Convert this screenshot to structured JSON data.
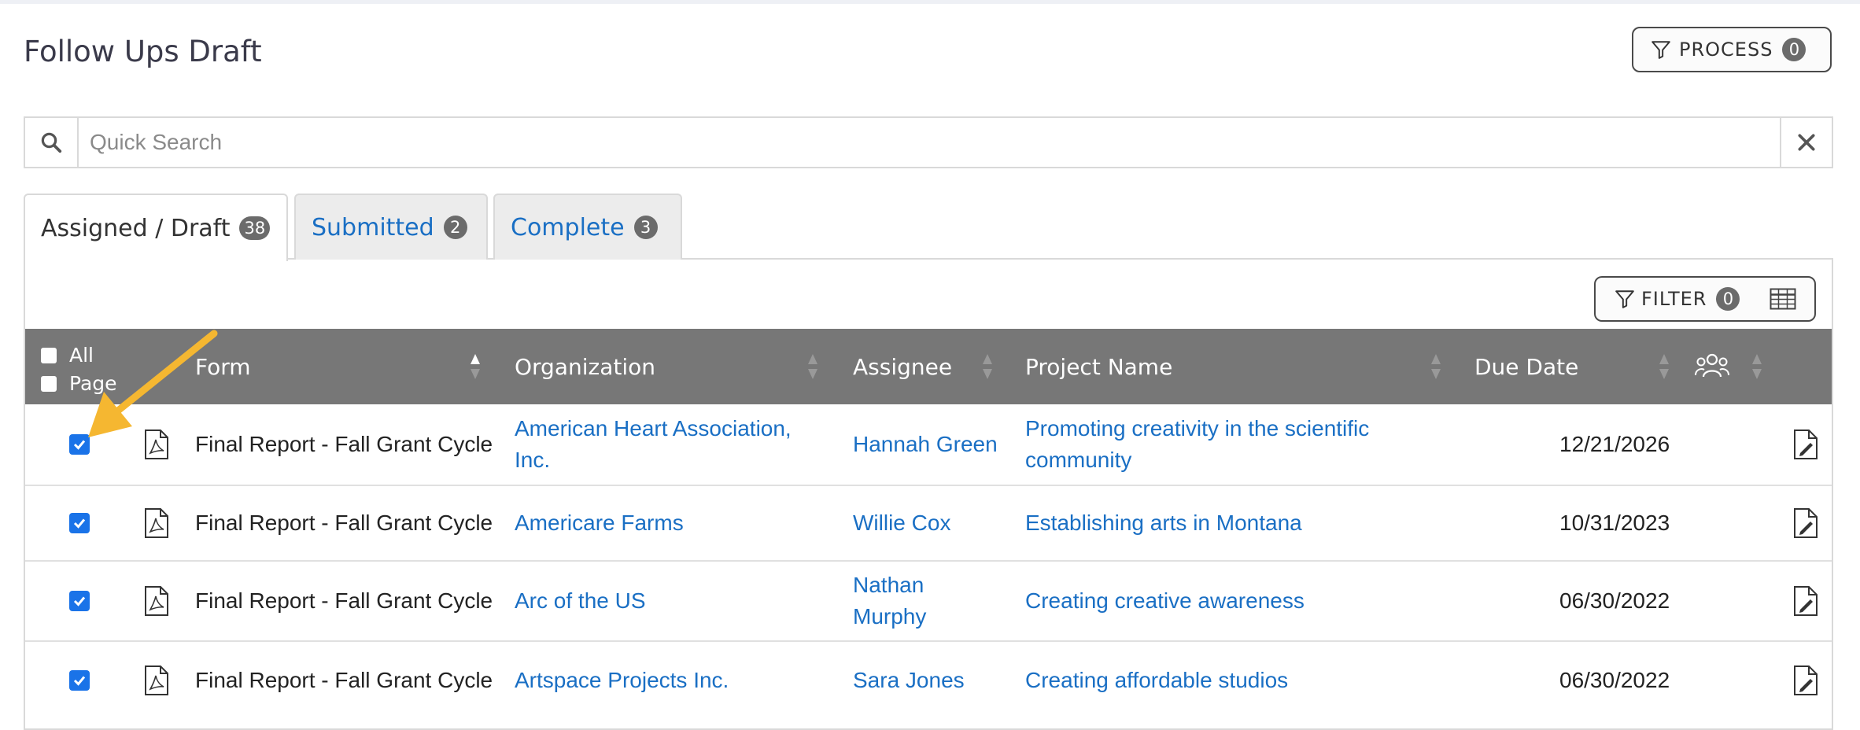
{
  "page": {
    "title": "Follow Ups Draft"
  },
  "process_button": {
    "label": "PROCESS",
    "count": "0"
  },
  "search": {
    "placeholder": "Quick Search",
    "value": ""
  },
  "tabs": [
    {
      "label": "Assigned / Draft",
      "count": "38",
      "active": true
    },
    {
      "label": "Submitted",
      "count": "2",
      "active": false
    },
    {
      "label": "Complete",
      "count": "3",
      "active": false
    }
  ],
  "filter_button": {
    "label": "FILTER",
    "count": "0"
  },
  "table": {
    "select_all_label": "All",
    "select_page_label": "Page",
    "columns": {
      "form": "Form",
      "organization": "Organization",
      "assignee": "Assignee",
      "project": "Project Name",
      "due_date": "Due Date"
    },
    "rows": [
      {
        "form": "Final Report - Fall Grant Cycle",
        "organization": "American Heart Association, Inc.",
        "assignee": "Hannah Green",
        "project": "Promoting creativity in the scientific community",
        "due_date": "12/21/2026",
        "checked": true
      },
      {
        "form": "Final Report - Fall Grant Cycle",
        "organization": "Americare Farms",
        "assignee": "Willie Cox",
        "project": "Establishing arts in Montana",
        "due_date": "10/31/2023",
        "checked": true
      },
      {
        "form": "Final Report - Fall Grant Cycle",
        "organization": "Arc of the US",
        "assignee": "Nathan Murphy",
        "project": "Creating creative awareness",
        "due_date": "06/30/2022",
        "checked": true
      },
      {
        "form": "Final Report - Fall Grant Cycle",
        "organization": "Artspace Projects Inc.",
        "assignee": "Sara Jones",
        "project": "Creating affordable studios",
        "due_date": "06/30/2022",
        "checked": true
      }
    ]
  },
  "colors": {
    "accent": "#1a6fc4",
    "header_bg": "#777777",
    "checkbox": "#1a73e8",
    "arrow": "#f5b731"
  },
  "icons": {
    "filter": "filter-funnel-icon",
    "search": "search-magnifier-icon",
    "clear": "close-x-icon",
    "table": "table-grid-icon",
    "users": "users-group-icon",
    "pdf": "pdf-file-icon",
    "edit": "edit-document-icon"
  }
}
